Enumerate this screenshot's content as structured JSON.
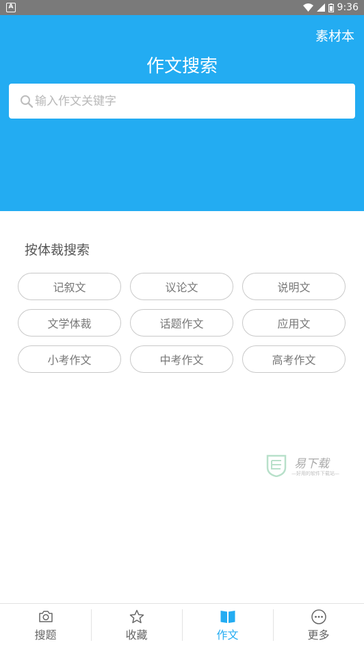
{
  "status_bar": {
    "time": "9:36"
  },
  "header": {
    "material_link": "素材本",
    "title": "作文搜索",
    "search_placeholder": "输入作文关键字"
  },
  "genre_section": {
    "title": "按体裁搜索",
    "items": [
      {
        "label": "记叙文"
      },
      {
        "label": "议论文"
      },
      {
        "label": "说明文"
      },
      {
        "label": "文学体裁"
      },
      {
        "label": "话题作文"
      },
      {
        "label": "应用文"
      },
      {
        "label": "小考作文"
      },
      {
        "label": "中考作文"
      },
      {
        "label": "高考作文"
      }
    ]
  },
  "watermark": {
    "text": "易下载",
    "subtext": "—好用的软件下载站—"
  },
  "bottom_nav": {
    "active": "作文",
    "items": [
      {
        "label": "搜题",
        "icon": "camera-icon"
      },
      {
        "label": "收藏",
        "icon": "star-icon"
      },
      {
        "label": "作文",
        "icon": "book-icon"
      },
      {
        "label": "更多",
        "icon": "more-icon"
      }
    ]
  },
  "colors": {
    "primary": "#23acf2",
    "status_bar": "#7a7a7a"
  }
}
